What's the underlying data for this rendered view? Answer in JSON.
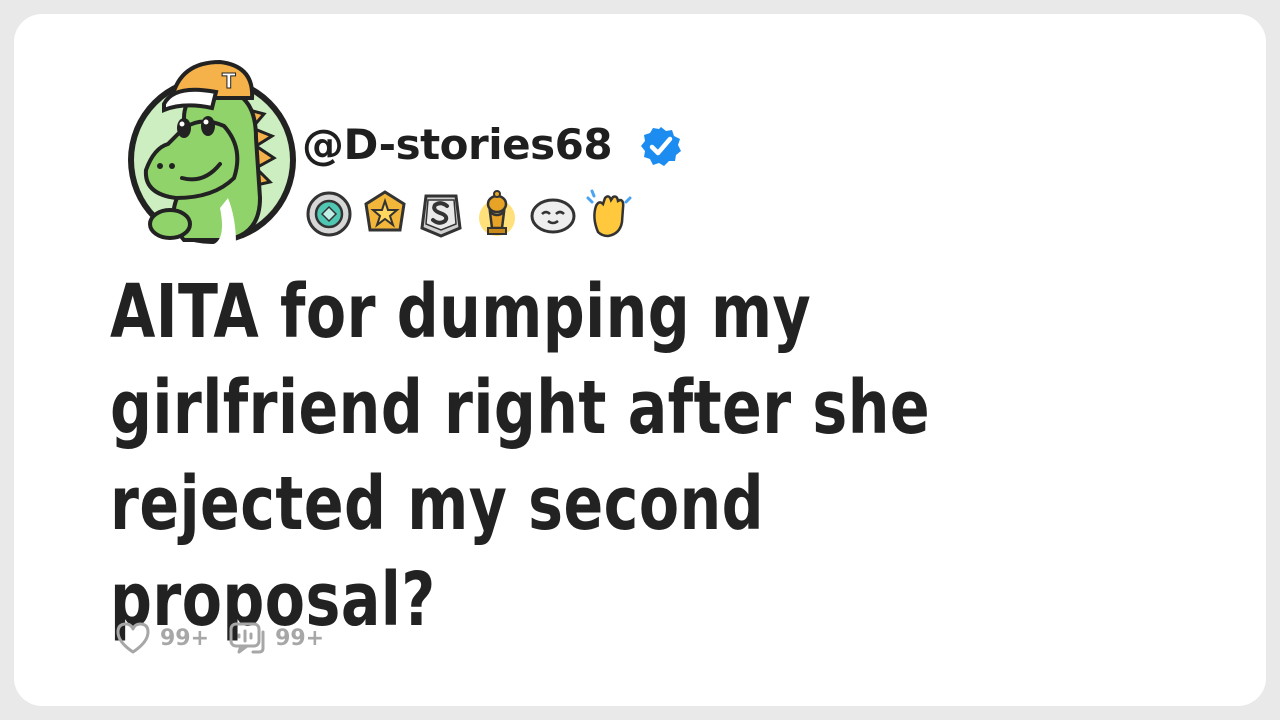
{
  "post": {
    "username": "@D-stories68",
    "title": "AITA for dumping my girlfriend right after she rejected my second proposal?"
  },
  "badges": [
    "gem-award-icon",
    "star-award-icon",
    "silver-s-award-icon",
    "gold-trophy-award-icon",
    "wholesome-seal-award-icon",
    "clapping-hands-award-icon"
  ],
  "footer": {
    "likes": "99+",
    "comments": "99+"
  },
  "colors": {
    "verified": "#1d8cf0",
    "text": "#222222",
    "muted": "#a7a7a7",
    "avatar_green": "#8fd36a"
  }
}
